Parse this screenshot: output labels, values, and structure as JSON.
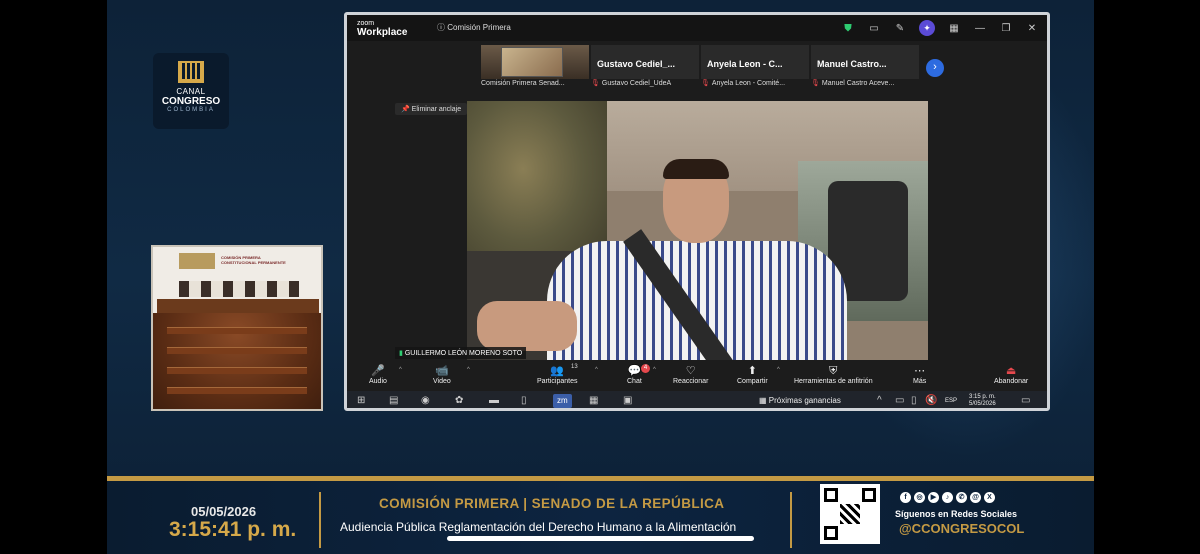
{
  "broadcast": {
    "logo": {
      "line1": "CANAL",
      "line2": "CONGRESO",
      "line3": "COLOMBIA"
    },
    "pip": {
      "title_line1": "COMISIÓN PRIMERA",
      "title_line2": "CONSTITUCIONAL PERMANENTE"
    }
  },
  "zoom": {
    "brand_small": "zoom",
    "brand_big": "Workplace",
    "meeting_title": "Comisión Primera",
    "titlebar_icons": [
      "shield-icon",
      "chat-bubble-icon",
      "pen-icon",
      "ai-companion-icon",
      "apps-icon",
      "minimize-icon",
      "restore-icon",
      "close-icon"
    ],
    "thumbnails": [
      {
        "caption": "Comisión Primera Senad...",
        "tile_name": ""
      },
      {
        "caption": "Gustavo Cediel_UdeA",
        "tile_name": "Gustavo  Cediel_..."
      },
      {
        "caption": "Anyela Leon - Comité...",
        "tile_name": "Anyela  Leon - C..."
      },
      {
        "caption": "Manuel Castro Aceve...",
        "tile_name": "Manuel  Castro..."
      }
    ],
    "unpin_label": "Eliminar anclaje",
    "speaker_name": "GUILLERMO LEÓN MORENO SOTO",
    "controls": {
      "audio": "Audio",
      "video": "Video",
      "participants": "Participantes",
      "participants_count": "13",
      "chat": "Chat",
      "chat_badge": "4",
      "react": "Reaccionar",
      "share": "Compartir",
      "host_tools": "Herramientas de anfitrión",
      "more": "Más",
      "leave": "Abandonar"
    },
    "taskbar": {
      "news": "Próximas ganancias",
      "lang": "ESP",
      "time": "3:15 p. m.",
      "date": "5/05/2026",
      "active_app": "zm"
    }
  },
  "lower_third": {
    "date": "05/05/2026",
    "time": "3:15:41 p. m.",
    "headline": "COMISIÓN PRIMERA | SENADO DE LA REPÚBLICA",
    "subtitle": "Audiencia Pública Reglamentación del Derecho Humano a la Alimentación",
    "follow_text": "Síguenos en Redes Sociales",
    "handle": "@CCONGRESOCOL",
    "social_icons": [
      "facebook-icon",
      "instagram-icon",
      "youtube-icon",
      "tiktok-icon",
      "whatsapp-icon",
      "threads-icon",
      "x-icon"
    ]
  },
  "colors": {
    "gold": "#c49a44",
    "navy": "#0d2440",
    "zoom_blue": "#2d6be0",
    "leave_red": "#e5484d"
  }
}
